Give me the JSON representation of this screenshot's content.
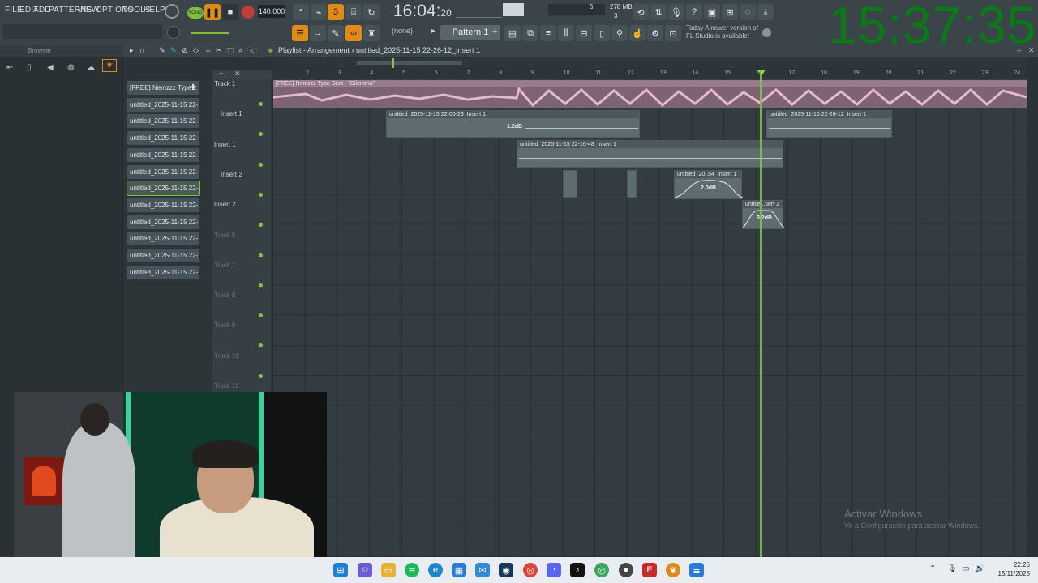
{
  "menu": [
    "FILE",
    "EDIT",
    "ADD",
    "PATTERNS",
    "VIEW",
    "OPTIONS",
    "TOOLS",
    "HELP"
  ],
  "transport": {
    "song_label": "SONG",
    "bpm": "140.000",
    "song_time": "16:04",
    "song_time_sub": "20",
    "pattern": "Pattern 1",
    "none": "(none)"
  },
  "memory": {
    "mb": "278 MB",
    "voices": "5",
    "cpu": "3"
  },
  "update_notice": {
    "line1": "Today  A newer version of",
    "line2": "FL Studio is available!"
  },
  "big_clock": "15:37:35",
  "browser": {
    "title": "Browser"
  },
  "playlist": {
    "title": "Playlist - Arrangement",
    "pattern_name": "untitled_2025-11-15 22-26-12_Insert 1"
  },
  "ruler_numbers": [
    "2",
    "3",
    "4",
    "5",
    "6",
    "7",
    "8",
    "9",
    "10",
    "11",
    "12",
    "13",
    "14",
    "15",
    "16",
    "17",
    "18",
    "19",
    "20",
    "21",
    "22",
    "23",
    "24"
  ],
  "patterns": [
    "[FREE] Nemzzz Type...",
    "untitled_2025-11-15 22-...",
    "untitled_2025-11-15 22-...",
    "untitled_2025-11-15 22-...",
    "untitled_2025-11-15 22-...",
    "untitled_2025-11-15 22-...",
    "untitled_2025-11-15 22-...",
    "untitled_2025-11-15 22-...",
    "untitled_2025-11-15 22-...",
    "untitled_2025-11-15 22-...",
    "untitled_2025-11-15 22-...",
    "untitled_2025-11-15 22-..."
  ],
  "tracks": [
    "Track 1",
    "Insert 1",
    "Insert 1",
    "Insert 2",
    "Insert 2",
    "Track 6",
    "Track 7",
    "Track 8",
    "Track 9",
    "Track 10",
    "Track 11"
  ],
  "clips": {
    "audio_main": "[FREE] Nemzzz Type Beat - \"Dilemma\"",
    "insert1a": "untitled_2025-11-15 22-00-29_Insert 1",
    "insert1b": "untitled_2025-11-15 22-26-12_Insert 1",
    "insert1c": "untitled_2025-11-15 22-16-48_Insert 1",
    "insert2a": "untitled_20..54_Insert 1",
    "insert2b": "untitle...sert 2",
    "db1": "1.2dB",
    "db2": "2.0dB",
    "db3": "3.2dB"
  },
  "watermark": {
    "line1": "Activar Windows",
    "line2": "Ve a Configuración para activar Windows."
  },
  "clock": {
    "time": "22:26",
    "date": "15/11/2025"
  },
  "colors": {
    "accent_orange": "#e08a18",
    "playhead_green": "#82c93e",
    "clock_green": "#0a7a16",
    "audio_clip_pink": "#c897b3"
  }
}
